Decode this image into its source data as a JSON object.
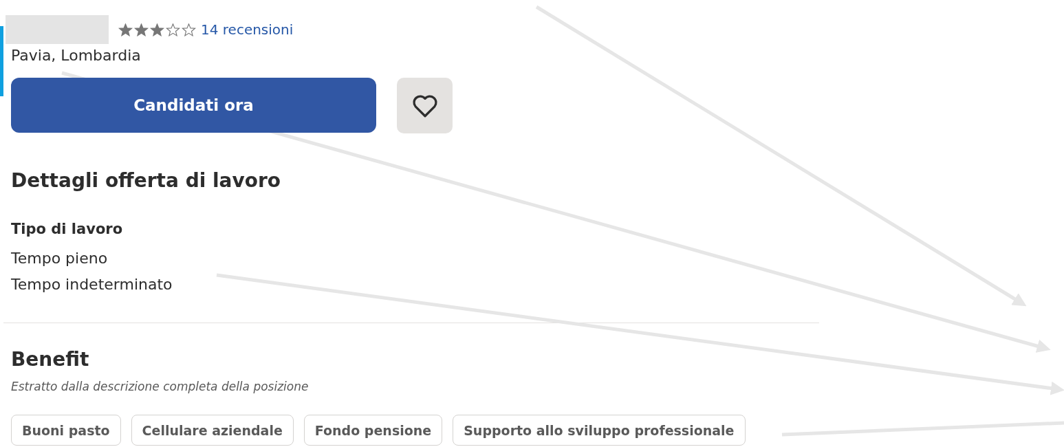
{
  "company": {
    "rating": {
      "stars": 3,
      "reviews": "14 recensioni"
    },
    "location": "Pavia, Lombardia"
  },
  "actions": {
    "apply": "Candidati ora",
    "save": {
      "saved": false
    }
  },
  "details": {
    "title": "Dettagli offerta di lavoro",
    "sections": [
      {
        "heading": "Tipo di lavoro",
        "values": [
          "Tempo pieno",
          "Tempo indeterminato"
        ]
      }
    ]
  },
  "benefits": {
    "title": "Benefit",
    "note": "Estratto dalla descrizione completa della posizione",
    "tags": [
      "Buoni pasto",
      "Cellulare aziendale",
      "Fondo pensione",
      "Supporto allo sviluppo professionale"
    ]
  }
}
